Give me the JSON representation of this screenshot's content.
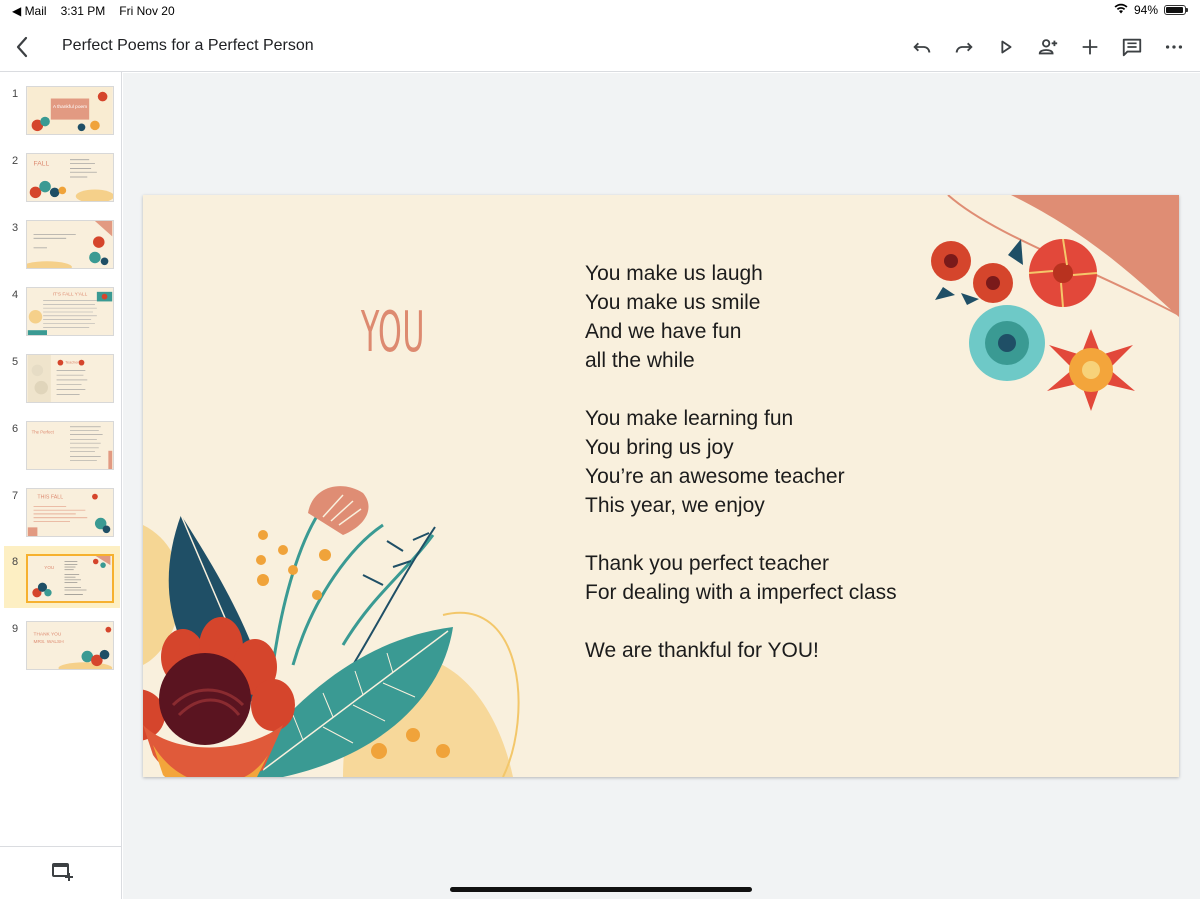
{
  "status_bar": {
    "back_app": "◀ Mail",
    "time": "3:31 PM",
    "date": "Fri Nov 20",
    "battery_text": "94%",
    "battery_level": 0.94,
    "wifi_icon": "wifi-icon"
  },
  "toolbar": {
    "title": "Perfect Poems for a Perfect Person",
    "tool_icons": [
      "undo-icon",
      "redo-icon",
      "present-icon",
      "add-person-icon",
      "add-icon",
      "comment-icon",
      "more-icon"
    ]
  },
  "filmstrip": {
    "selected_slide": 8,
    "slides": [
      {
        "number": "1"
      },
      {
        "number": "2"
      },
      {
        "number": "3"
      },
      {
        "number": "4"
      },
      {
        "number": "5"
      },
      {
        "number": "6"
      },
      {
        "number": "7"
      },
      {
        "number": "8"
      },
      {
        "number": "9"
      }
    ],
    "thumb_text": {
      "t1": "A thankful poem",
      "t2": "FALL",
      "t4": "IT'S FALL Y'ALL",
      "t5": "Teacher",
      "t6": "The Perfect",
      "t7": "THIS FALL",
      "t8": "YOU",
      "t9a": "THANK YOU",
      "t9b": "MRS. WALSH"
    }
  },
  "slide": {
    "title": "YOU",
    "stanzas": [
      [
        "You make us laugh",
        "You make us smile",
        "And we have fun",
        "all the while"
      ],
      [
        "You make learning fun",
        "You bring us joy",
        "You’re an awesome teacher",
        "This year, we enjoy"
      ],
      [
        "Thank you perfect teacher",
        "For dealing with a imperfect class"
      ],
      [
        "We are thankful for YOU!"
      ]
    ]
  },
  "colors": {
    "slide_bg": "#f9f0dd",
    "accent_salmon": "#dd8a70",
    "teal": "#3a9a93",
    "dark_teal": "#1f4f66",
    "red": "#d5452c",
    "orange": "#f0a33a",
    "selection": "#fdefc3",
    "selection_border": "#f6b12e"
  }
}
